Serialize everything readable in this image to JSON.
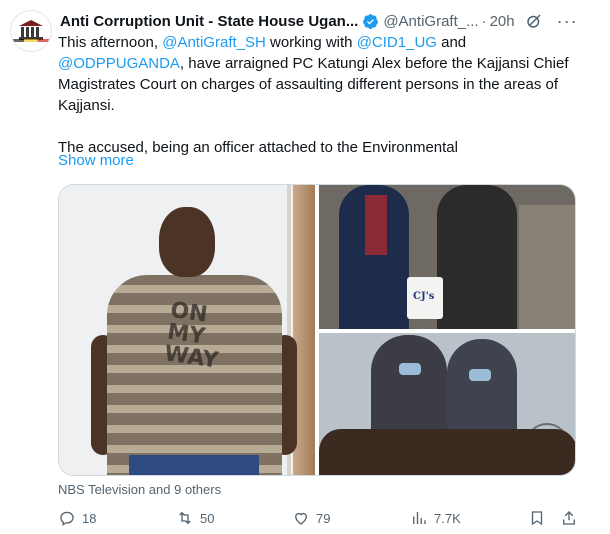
{
  "tweet": {
    "display_name": "Anti Corruption Unit - State House Ugan...",
    "handle": "@AntiGraft_...",
    "separator": "·",
    "time": "20h",
    "text_parts": [
      "This afternoon, ",
      "@AntiGraft_SH",
      " working with ",
      "@CID1_UG",
      " and ",
      "@ODPPUGANDA",
      ", have arraigned PC Katungi Alex before the Kajjansi Chief Magistrates Court on charges of assaulting different persons in the areas of Kajjansi."
    ],
    "text_para2": "The accused, being an officer attached to the Environmental",
    "show_more": "Show more",
    "shirt_print": "ON MY WAY",
    "bag_print": "CJ's",
    "attribution": "NBS Television and 9 others"
  },
  "actions": {
    "reply_count": "18",
    "retweet_count": "50",
    "like_count": "79",
    "views_count": "7.7K"
  },
  "colors": {
    "accent": "#1d9bf0",
    "secondary_text": "#536471",
    "verified": "#1d9bf0"
  },
  "icons": [
    "verified-badge-icon",
    "grok-icon",
    "more-icon",
    "reply-icon",
    "retweet-icon",
    "like-icon",
    "views-icon",
    "bookmark-icon",
    "share-icon"
  ]
}
